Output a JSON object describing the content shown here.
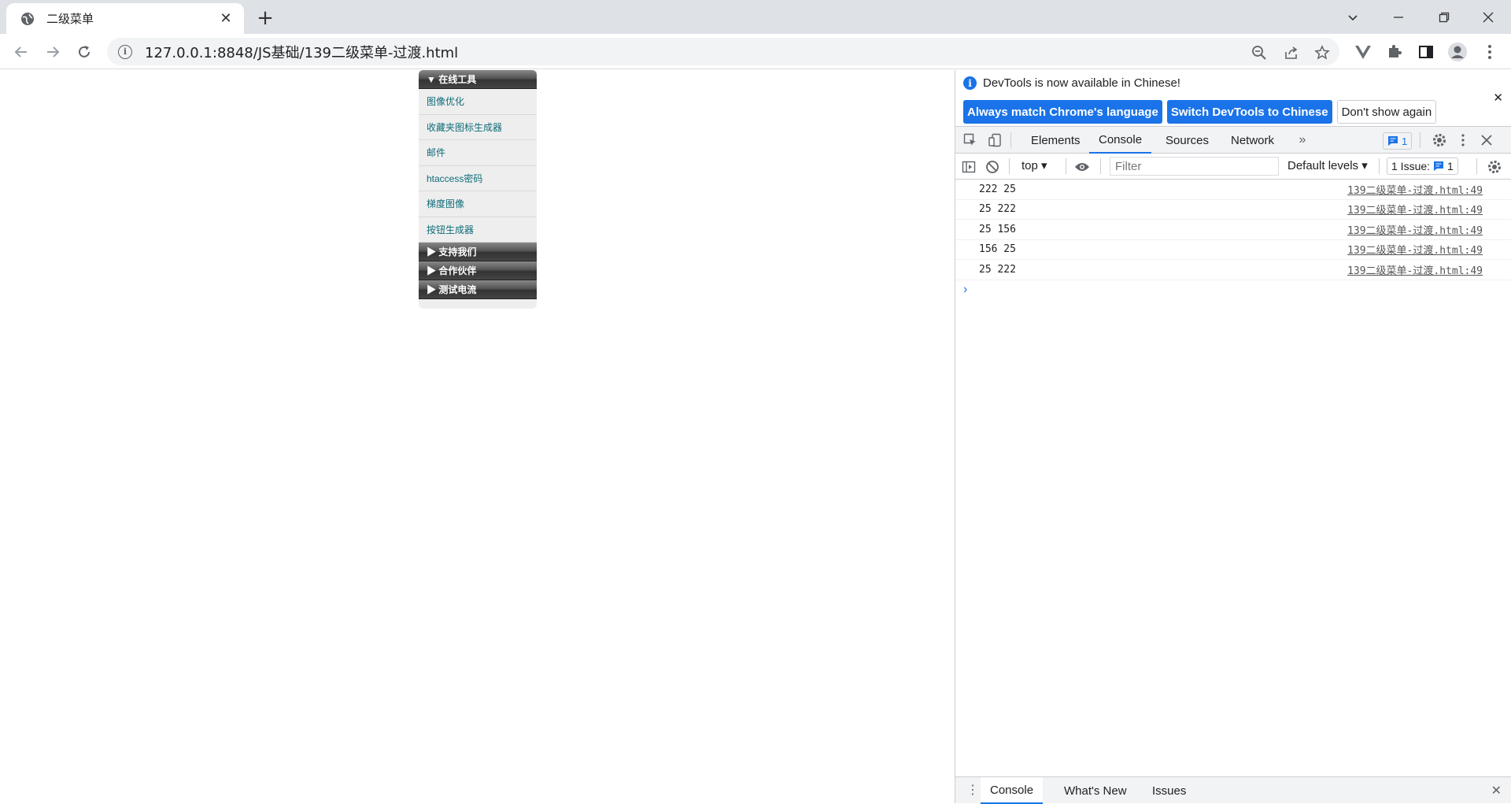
{
  "browser": {
    "tab_title": "二级菜单",
    "url": "127.0.0.1:8848/JS基础/139二级菜单-过渡.html"
  },
  "menu": {
    "sections": [
      {
        "title": "▼ 在线工具",
        "items": [
          "图像优化",
          "收藏夹图标生成器",
          "邮件",
          "htaccess密码",
          "梯度图像",
          "按钮生成器"
        ]
      },
      {
        "title": "▶ 支持我们",
        "items": []
      },
      {
        "title": "▶ 合作伙伴",
        "items": []
      },
      {
        "title": "▶ 测试电流",
        "items": []
      }
    ]
  },
  "devtools": {
    "info_message": "DevTools is now available in Chinese!",
    "btn_match": "Always match Chrome's language",
    "btn_switch": "Switch DevTools to Chinese",
    "btn_dont_show": "Don't show again",
    "tabs": [
      "Elements",
      "Console",
      "Sources",
      "Network"
    ],
    "active_tab": "Console",
    "messages_badge": "1",
    "context": "top",
    "filter_placeholder": "Filter",
    "levels": "Default levels",
    "issues_label": "1 Issue:",
    "issues_count": "1",
    "logs": [
      {
        "text": "222 25",
        "source": "139二级菜单-过渡.html:49"
      },
      {
        "text": "25 222",
        "source": "139二级菜单-过渡.html:49"
      },
      {
        "text": "25 156",
        "source": "139二级菜单-过渡.html:49"
      },
      {
        "text": "156 25",
        "source": "139二级菜单-过渡.html:49"
      },
      {
        "text": "25 222",
        "source": "139二级菜单-过渡.html:49"
      }
    ],
    "drawer_tabs": [
      "Console",
      "What's New",
      "Issues"
    ]
  },
  "colors": {
    "accent": "#1a73e8",
    "menu_link": "#0e6c78"
  }
}
